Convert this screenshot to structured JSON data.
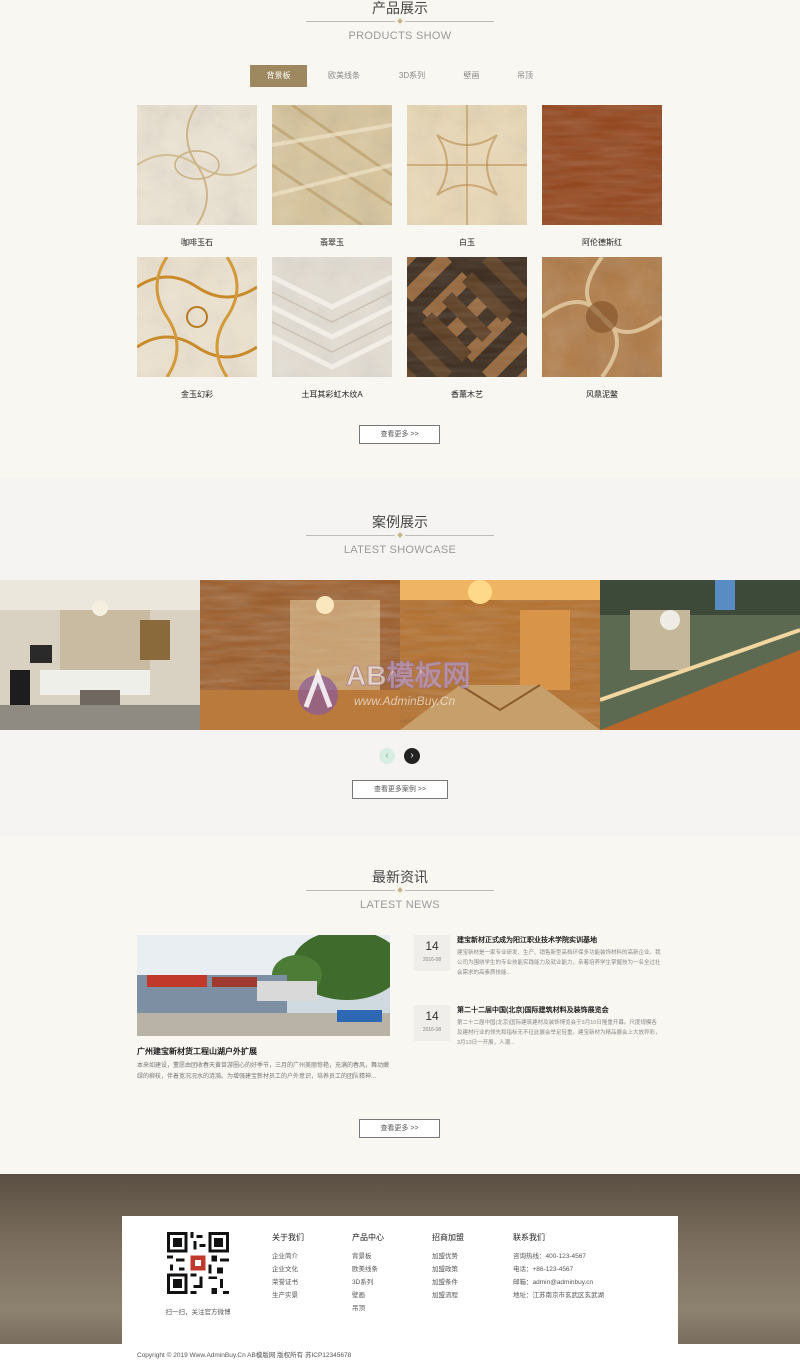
{
  "products": {
    "title_cn": "产品展示",
    "title_en": "PRODUCTS SHOW",
    "tabs": [
      "背景板",
      "欧美线条",
      "3D系列",
      "壁画",
      "吊顶"
    ],
    "items": [
      {
        "name": "咖啡玉石",
        "style": "marble-cream"
      },
      {
        "name": "翡翠玉",
        "style": "marble-gold"
      },
      {
        "name": "白玉",
        "style": "marble-white"
      },
      {
        "name": "阿伦德斯红",
        "style": "wood-red"
      },
      {
        "name": "金玉幻彩",
        "style": "marble-orange"
      },
      {
        "name": "土耳其彩虹木纹A",
        "style": "marble-grey"
      },
      {
        "name": "香薰木艺",
        "style": "wood-herringbone"
      },
      {
        "name": "风鼎泥鳖",
        "style": "marble-brown"
      }
    ],
    "more": "查看更多 >>"
  },
  "showcase": {
    "title_cn": "案例展示",
    "title_en": "LATEST SHOWCASE",
    "watermark_text": "AB模板网",
    "watermark_sub": "www.AdminBuy.Cn",
    "prev_icon": "‹",
    "next_icon": "›",
    "more": "查看更多案例 >>"
  },
  "news": {
    "title_cn": "最新资讯",
    "title_en": "LATEST NEWS",
    "main": {
      "title": "广州建宝新材货工程山湖户外扩展",
      "desc": "本来如建设，董愿由团收春天黄苗游圈心的好季节，三月的广州美丽惊艳，充满的春风，舞动嫩绿的柳枝，伴着宽况况水的涟漪。为增强建宝新材员工的户外意识，培养员工的团队精神..."
    },
    "items": [
      {
        "day": "14",
        "ym": "2016-08",
        "title": "建宝新材正式成为阳江职业技术学院实训基地",
        "summary": "建宝新材是一家专业研发、生产、销售新型高档环保多功能装饰材料的高新企业。我公司为围绕学生的专业技能实践能力及就业能力，亲着培养学生掌握技为一名全过社会需求的高素质技能..."
      },
      {
        "day": "14",
        "ym": "2016-08",
        "title": "第二十二届中国(北京)国际建筑材料及装饰展览会",
        "summary": "第二十二届中国(北京)国际建筑建材及装饰博览会于3月10日隆重开幕。尺度规模各及建材行业的领先和指标无不征此展会举足轻重。建宝新材为精品展会上大放异彩，3月13日一开展，人潮..."
      }
    ],
    "more": "查看更多 >>"
  },
  "footer": {
    "qr_caption": "扫一扫，关注官方微博",
    "columns": [
      {
        "heading": "关于我们",
        "items": [
          "企业简介",
          "企业文化",
          "荣誉证书",
          "生产实景"
        ]
      },
      {
        "heading": "产品中心",
        "items": [
          "背景板",
          "欧美线条",
          "3D系列",
          "壁画",
          "吊顶"
        ]
      },
      {
        "heading": "招商加盟",
        "items": [
          "加盟优势",
          "加盟政策",
          "加盟条件",
          "加盟流程"
        ]
      },
      {
        "heading": "联系我们",
        "items": [
          "咨询热线：400-123-4567",
          "电话：+86-123-4567",
          "邮箱：admin@adminbuy.cn",
          "地址：江苏南京市玄武区玄武湖"
        ]
      }
    ],
    "copyright": "Copyright © 2019 Www.AdminBuy.Cn AB模版网 版权所有    苏ICP12345678"
  },
  "colors": {
    "accent": "#9d8860",
    "bg": "#f9f7f2"
  }
}
